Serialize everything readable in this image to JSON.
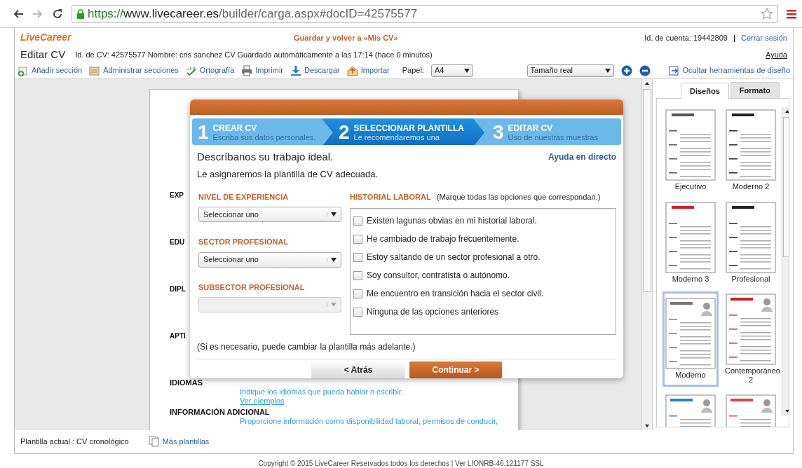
{
  "browser": {
    "url_scheme": "https://",
    "url_host": "www.livecareer.es",
    "url_path": "/builder/carga.aspx#docID=42575577"
  },
  "header": {
    "logo": "LiveCareer",
    "save_link": "Guardar y volver a «Mis CV»",
    "account": "Id. de cuenta: 19442809",
    "separator": "|",
    "logout": "Cerrar sesión"
  },
  "editor": {
    "title": "Editar CV",
    "info": "Id. de CV: 42575577 Nombre:  cris sanchez CV  Guardado automáticamente a las 17:14  (hace 0 minutos)",
    "help": "Ayuda"
  },
  "toolbar": {
    "items": [
      {
        "kind": "add",
        "label": "Añadir sección"
      },
      {
        "kind": "manage",
        "label": "Administrar secciones"
      },
      {
        "kind": "spell",
        "label": "Ortografía"
      },
      {
        "kind": "print",
        "label": "Imprimir"
      },
      {
        "kind": "download",
        "label": "Descargar"
      },
      {
        "kind": "import",
        "label": "Importar"
      }
    ],
    "paper_label": "Papel:",
    "paper": "A4",
    "zoom": "Tamaño real",
    "hide_tools": "Ocultar herramientas de diseño"
  },
  "document": {
    "sections": [
      {
        "heading": "EXP"
      },
      {
        "heading": "EDU"
      },
      {
        "heading": "DIPL"
      },
      {
        "heading": "APTI"
      },
      {
        "heading": "IDIOMAS",
        "hint": "Indique los idiomas que pueda hablar o escribir.",
        "link": "Ver ejemplos"
      },
      {
        "heading": "INFORMACIÓN ADICIONAL",
        "hint": "Proporcione información como disponibilidad laboral, permisos de conducir,"
      }
    ]
  },
  "design_panel": {
    "tabs": [
      {
        "label": "Diseños",
        "selected": true
      },
      {
        "label": "Formato",
        "selected": false
      }
    ],
    "templates": [
      {
        "name": "Ejecutivo",
        "selected": false,
        "color": "#555555",
        "photo": false
      },
      {
        "name": "Moderno 2",
        "selected": false,
        "color": "#222222",
        "photo": false
      },
      {
        "name": "Moderno 3",
        "selected": false,
        "color": "#d0202a",
        "photo": false
      },
      {
        "name": "Profesional",
        "selected": false,
        "color": "#222222",
        "photo": false
      },
      {
        "name": "Moderno",
        "selected": true,
        "color": "#777777",
        "photo": true
      },
      {
        "name": "Contemporáneo 2",
        "selected": false,
        "color": "#d0202a",
        "photo": true
      },
      {
        "selected": false,
        "color": "#2a7fd0",
        "photo": true
      },
      {
        "selected": false,
        "color": "#e0404a",
        "photo": true
      }
    ]
  },
  "wizard": {
    "steps": [
      {
        "number": "1",
        "title": "CREAR CV",
        "subtitle": "Escriba sus datos personales.",
        "selected": false
      },
      {
        "number": "2",
        "title": "SELECCIONAR PLANTILLA",
        "subtitle": "Le recomendaremos una",
        "selected": true
      },
      {
        "number": "3",
        "title": "EDITAR CV",
        "subtitle": "Uso de nuestras muestras",
        "selected": false
      }
    ],
    "heading": "Descríbanos su trabajo ideal.",
    "help_link": "Ayuda en directo",
    "intro": "Le asignaremos la plantilla de CV adecuada.",
    "fields": [
      {
        "label": "NIVEL DE EXPERIENCIA",
        "value": "Seleccionar uno",
        "disabled": false
      },
      {
        "label": "SECTOR PROFESIONAL",
        "value": "Seleccionar uno",
        "disabled": false
      },
      {
        "label": "SUBSECTOR PROFESIONAL",
        "disabled": true
      }
    ],
    "history": {
      "label": "HISTORIAL LABORAL",
      "hint": "(Marque todas las opciones que correspondan.)",
      "options": [
        {
          "label": "Existen lagunas obvias en mi historial laboral.",
          "checked": false
        },
        {
          "label": "He cambiado de trabajo frecuentemente.",
          "checked": false
        },
        {
          "label": "Estoy saltando de un sector profesional a otro.",
          "checked": false
        },
        {
          "label": "Soy consultor, contratista o autónomo.",
          "checked": false
        },
        {
          "label": "Me encuentro en transición hacia el sector civil.",
          "checked": false
        },
        {
          "label": "Ninguna de las opciones anteriores",
          "checked": false
        }
      ]
    },
    "note": "(Si es necesario, puede cambiar la plantilla más adelante.)",
    "back_button": "< Atrás",
    "continue_button": "Continuar >"
  },
  "footer": {
    "current_template": "Plantilla actual : CV cronológico",
    "more_templates": "Más plantillas",
    "copyright": "Copyright © 2015 LiveCareer Reservados todos los derechos |  Ver LIONRB-46.121177 SSL"
  }
}
